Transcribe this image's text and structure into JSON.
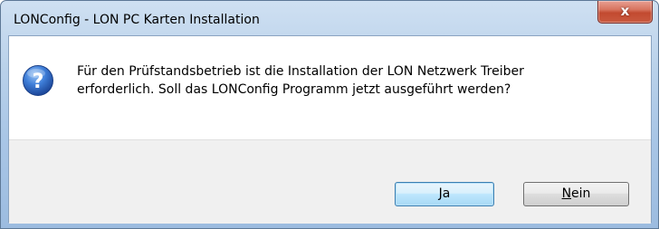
{
  "window": {
    "title": "LONConfig - LON PC Karten Installation",
    "close_glyph": "x"
  },
  "dialog": {
    "icon": "question-icon",
    "message_line1": "Für den Prüfstandsbetrieb ist die Installation der LON Netzwerk Treiber",
    "message_line2": "erforderlich. Soll das LONConfig Programm jetzt ausgeführt werden?"
  },
  "buttons": {
    "yes_label": "Ja",
    "no_label_accel": "N",
    "no_label_rest": "ein"
  },
  "colors": {
    "titlebar": "#b9d1ea",
    "close_button": "#c9593f",
    "default_button_border": "#3c7fb1",
    "question_icon": "#2a63c9"
  }
}
